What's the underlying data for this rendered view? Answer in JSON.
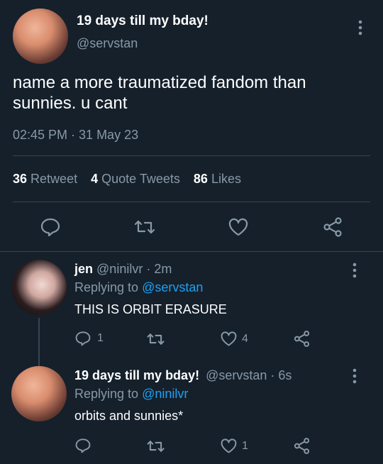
{
  "main_tweet": {
    "display_name": "19 days till my bday!",
    "handle": "@servstan",
    "text_line1": "name a more traumatized fandom than",
    "text_line2": "sunnies. u cant",
    "timestamp": "02:45 PM · 31 May 23",
    "stats": {
      "retweet_count": "36",
      "retweet_label": "Retweet",
      "quote_count": "4",
      "quote_label": "Quote Tweets",
      "like_count": "86",
      "like_label": "Likes"
    }
  },
  "replies": [
    {
      "display_name": "jen",
      "handle_time": "@ninilvr · 2m",
      "replying_prefix": "Replying to ",
      "replying_to": "@servstan",
      "text": "THIS IS ORBIT ERASURE",
      "reply_count": "1",
      "retweet_count": "",
      "like_count": "4"
    },
    {
      "display_name": "19 days till my bday!",
      "handle_time": "@servstan · 6s",
      "replying_prefix": "Replying to ",
      "replying_to": "@ninilvr",
      "text": "orbits and sunnies*",
      "reply_count": "",
      "retweet_count": "",
      "like_count": "1"
    }
  ],
  "colors": {
    "background": "#15202b",
    "secondary_text": "#8899a6",
    "link": "#1da1f2",
    "divider": "#38444d"
  },
  "icons": [
    "more-vertical-icon",
    "reply-icon",
    "retweet-icon",
    "like-icon",
    "share-icon"
  ]
}
